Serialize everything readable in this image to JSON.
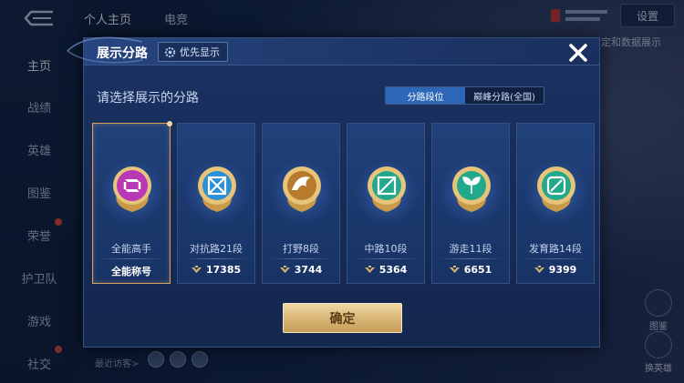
{
  "background": {
    "sidebar": [
      {
        "label": "主页",
        "active": true
      },
      {
        "label": "战绩"
      },
      {
        "label": "英雄"
      },
      {
        "label": "图鉴"
      },
      {
        "label": "荣誉"
      },
      {
        "label": "护卫队"
      },
      {
        "label": "游戏"
      },
      {
        "label": "社交"
      }
    ],
    "tabs": [
      "个人主页",
      "电竞"
    ],
    "settings_label": "设置",
    "right_text": "定和数据展示",
    "visitors_label": "最近访客>",
    "right_buttons": [
      {
        "label": "图鉴"
      },
      {
        "label": "换英雄"
      }
    ]
  },
  "modal": {
    "title": "展示分路",
    "priority_label": "优先显示",
    "subtitle": "请选择展示的分路",
    "segments": [
      "分路段位",
      "巅峰分路(全国)"
    ],
    "confirm_label": "确定",
    "cards": [
      {
        "name": "全能高手",
        "score": "全能称号",
        "icon": "allround-emblem",
        "color": "#b838b6",
        "selected": true
      },
      {
        "name": "对抗路21段",
        "score": "17385",
        "icon": "clash-lane-emblem",
        "color": "#2b8fd6"
      },
      {
        "name": "打野8段",
        "score": "3744",
        "icon": "jungle-emblem",
        "color": "#b77b2e"
      },
      {
        "name": "中路10段",
        "score": "5364",
        "icon": "mid-lane-emblem",
        "color": "#22a88b"
      },
      {
        "name": "游走11段",
        "score": "6651",
        "icon": "roam-emblem",
        "color": "#22a88b"
      },
      {
        "name": "发育路14段",
        "score": "9399",
        "icon": "farm-lane-emblem",
        "color": "#22a88b"
      }
    ]
  },
  "colors": {
    "accent_gold": "#d9a25a",
    "segment_active": "#2e67b8",
    "modal_bg": "#1b3364"
  }
}
